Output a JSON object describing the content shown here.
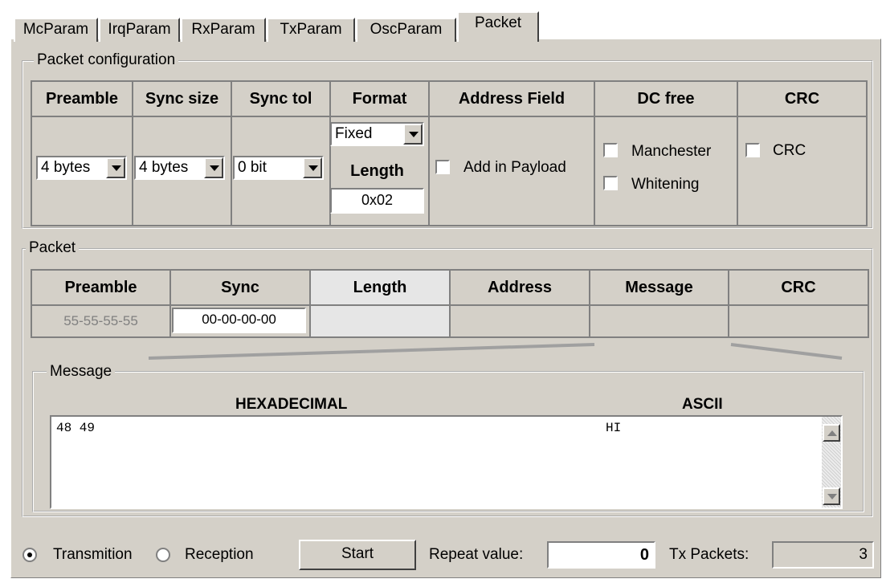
{
  "tabs": [
    "McParam",
    "IrqParam",
    "RxParam",
    "TxParam",
    "OscParam",
    "Packet"
  ],
  "active_tab": "Packet",
  "packet_config": {
    "title": "Packet configuration",
    "headers": [
      "Preamble",
      "Sync size",
      "Sync tol",
      "Format",
      "Address Field",
      "DC free",
      "CRC"
    ],
    "preamble_value": "4 bytes",
    "sync_size_value": "4 bytes",
    "sync_tol_value": "0 bit",
    "format_value": "Fixed",
    "length_label": "Length",
    "length_value": "0x02",
    "address_checkbox_label": "Add in Payload",
    "dc_manchester_label": "Manchester",
    "dc_whitening_label": "Whitening",
    "crc_checkbox_label": "CRC"
  },
  "packet": {
    "title": "Packet",
    "headers": [
      "Preamble",
      "Sync",
      "Length",
      "Address",
      "Message",
      "CRC"
    ],
    "preamble_value": "55-55-55-55",
    "sync_value": "00-00-00-00"
  },
  "message": {
    "title": "Message",
    "hex_header": "HEXADECIMAL",
    "ascii_header": "ASCII",
    "hex_content": "48 49",
    "ascii_content": "HI"
  },
  "bottom": {
    "transmition_label": "Transmition",
    "reception_label": "Reception",
    "start_label": "Start",
    "repeat_label": "Repeat value:",
    "repeat_value": "0",
    "tx_packets_label": "Tx Packets:",
    "tx_packets_value": "3"
  }
}
